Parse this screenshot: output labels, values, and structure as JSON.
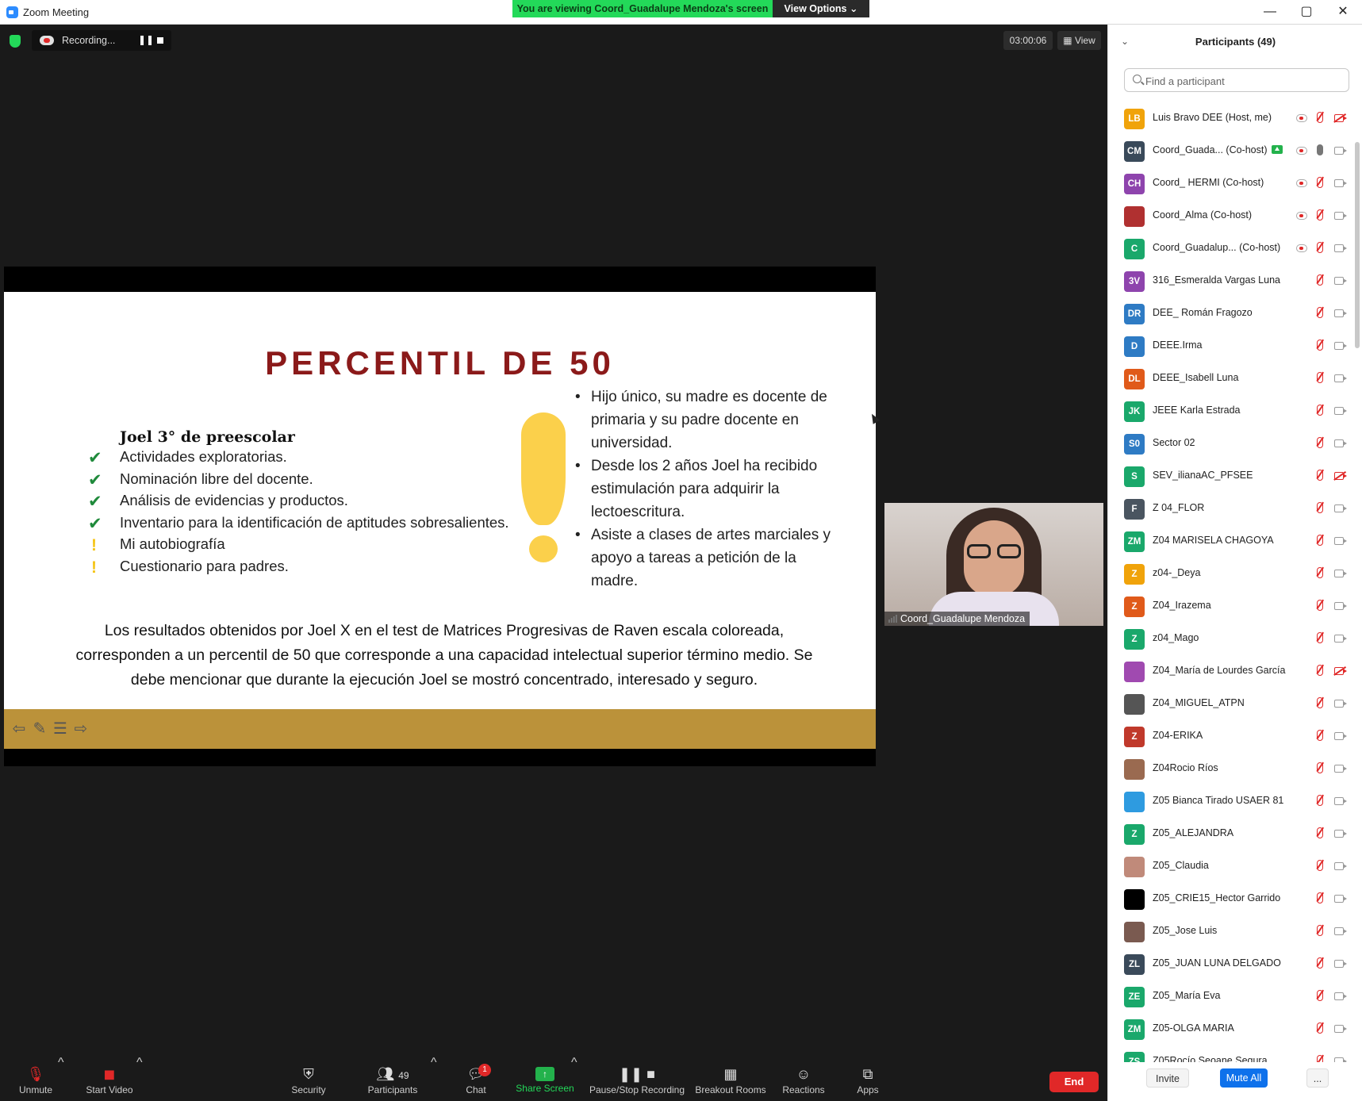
{
  "window": {
    "title": "Zoom Meeting",
    "viewing_banner": "You are viewing Coord_Guadalupe Mendoza's screen",
    "view_options": "View Options ⌄",
    "controls": [
      "—",
      "▢",
      "✕"
    ]
  },
  "top_bar": {
    "recording_label": "Recording...",
    "timer": "03:00:06",
    "view_label": "View"
  },
  "slide": {
    "title": "PERCENTIL  DE 50",
    "subhead": "Joel 3° de preescolar",
    "items": [
      {
        "mark": "check",
        "text": "Actividades exploratorias."
      },
      {
        "mark": "check",
        "text": "Nominación libre del docente."
      },
      {
        "mark": "check",
        "text": "Análisis de evidencias y productos."
      },
      {
        "mark": "check",
        "text": "Inventario para la identificación de aptitudes sobresalientes."
      },
      {
        "mark": "warn",
        "text": "Mi autobiografía"
      },
      {
        "mark": "warn",
        "text": "Cuestionario para padres."
      }
    ],
    "bullets": [
      "Hijo único, su madre es docente de primaria y su padre docente en universidad.",
      "Desde los 2 años Joel ha recibido estimulación para adquirir la lectoescritura.",
      "Asiste a clases de artes marciales y apoyo a tareas a petición de la madre."
    ],
    "conclusion": "Los resultados obtenidos por  Joel  X en el test de Matrices Progresivas de Raven escala coloreada, corresponden a un percentil de  50 que corresponde a una capacidad intelectual superior término medio. Se debe mencionar que durante la ejecución Joel se mostró concentrado,  interesado y seguro."
  },
  "self_video": {
    "name": "Coord_Guadalupe Mendoza"
  },
  "toolbar": {
    "unmute": "Unmute",
    "start_video": "Start Video",
    "security": "Security",
    "participants": "Participants",
    "participants_count": "49",
    "chat": "Chat",
    "chat_badge": "1",
    "share_screen": "Share Screen",
    "pause_stop_recording": "Pause/Stop Recording",
    "breakout_rooms": "Breakout Rooms",
    "reactions": "Reactions",
    "apps": "Apps",
    "end": "End"
  },
  "panel": {
    "title": "Participants (49)",
    "search_placeholder": "Find a participant",
    "invite": "Invite",
    "mute_all": "Mute All",
    "more": "...",
    "participants": [
      {
        "initials": "LB",
        "color": "#f0a30a",
        "name": "Luis Bravo DEE (Host, me)",
        "rec": true,
        "mic": "muted",
        "cam": "off"
      },
      {
        "initials": "CM",
        "color": "#3a4a5a",
        "name": "Coord_Guada... (Co-host)",
        "sharing": true,
        "rec": true,
        "mic": "on",
        "cam": "on"
      },
      {
        "initials": "CH",
        "color": "#8e44ad",
        "name": "Coord_ HERMI (Co-host)",
        "rec": true,
        "mic": "muted",
        "cam": "on"
      },
      {
        "initials": "",
        "color": "#b03030",
        "name": "Coord_Alma (Co-host)",
        "rec": true,
        "mic": "muted",
        "cam": "on"
      },
      {
        "initials": "C",
        "color": "#1aa86b",
        "name": "Coord_Guadalup...  (Co-host)",
        "rec": true,
        "mic": "muted",
        "cam": "on"
      },
      {
        "initials": "3V",
        "color": "#8e44ad",
        "name": "316_Esmeralda Vargas Luna",
        "mic": "muted",
        "cam": "on"
      },
      {
        "initials": "DR",
        "color": "#2e7bc4",
        "name": "DEE_ Román Fragozo",
        "mic": "muted",
        "cam": "on"
      },
      {
        "initials": "D",
        "color": "#2e7bc4",
        "name": "DEEE.Irma",
        "mic": "muted",
        "cam": "on"
      },
      {
        "initials": "DL",
        "color": "#e05a1a",
        "name": "DEEE_Isabell Luna",
        "mic": "muted",
        "cam": "on"
      },
      {
        "initials": "JK",
        "color": "#1aa86b",
        "name": "JEEE Karla Estrada",
        "mic": "muted",
        "cam": "on"
      },
      {
        "initials": "S0",
        "color": "#2e7bc4",
        "name": "Sector 02",
        "mic": "muted",
        "cam": "on"
      },
      {
        "initials": "S",
        "color": "#1aa86b",
        "name": "SEV_ilianaAC_PFSEE",
        "mic": "muted",
        "cam": "off"
      },
      {
        "initials": "F",
        "color": "#4a5560",
        "name": "Z 04_FLOR",
        "mic": "muted",
        "cam": "on"
      },
      {
        "initials": "ZM",
        "color": "#1aa86b",
        "name": "Z04 MARISELA CHAGOYA",
        "mic": "muted",
        "cam": "on"
      },
      {
        "initials": "Z",
        "color": "#f0a30a",
        "name": "z04-_Deya",
        "mic": "muted",
        "cam": "on"
      },
      {
        "initials": "Z",
        "color": "#e05a1a",
        "name": "Z04_Irazema",
        "mic": "muted",
        "cam": "on"
      },
      {
        "initials": "Z",
        "color": "#1aa86b",
        "name": "z04_Mago",
        "mic": "muted",
        "cam": "on"
      },
      {
        "initials": "",
        "color": "#a04ab0",
        "name": "Z04_María de Lourdes García",
        "mic": "muted",
        "cam": "off"
      },
      {
        "initials": "",
        "color": "#555555",
        "name": "Z04_MIGUEL_ATPN",
        "mic": "muted",
        "cam": "on"
      },
      {
        "initials": "Z",
        "color": "#c0392b",
        "name": "Z04-ERIKA",
        "mic": "muted",
        "cam": "on"
      },
      {
        "initials": "",
        "color": "#9a6a50",
        "name": "Z04Rocio Ríos",
        "mic": "muted",
        "cam": "on"
      },
      {
        "initials": "",
        "color": "#2e9be0",
        "name": "Z05 Bianca Tirado USAER 81",
        "mic": "muted",
        "cam": "on"
      },
      {
        "initials": "Z",
        "color": "#1aa86b",
        "name": "Z05_ALEJANDRA",
        "mic": "muted",
        "cam": "on"
      },
      {
        "initials": "",
        "color": "#c08a7a",
        "name": "Z05_Claudia",
        "mic": "muted",
        "cam": "on"
      },
      {
        "initials": "",
        "color": "#000000",
        "name": "Z05_CRIE15_Hector Garrido",
        "mic": "muted",
        "cam": "on"
      },
      {
        "initials": "",
        "color": "#7a5a50",
        "name": "Z05_Jose Luis",
        "mic": "muted",
        "cam": "on"
      },
      {
        "initials": "ZL",
        "color": "#3a4a5a",
        "name": "Z05_JUAN LUNA DELGADO",
        "mic": "muted",
        "cam": "on"
      },
      {
        "initials": "ZE",
        "color": "#1aa86b",
        "name": "Z05_María Eva",
        "mic": "muted",
        "cam": "on"
      },
      {
        "initials": "ZM",
        "color": "#1aa86b",
        "name": "Z05-OLGA MARIA",
        "mic": "muted",
        "cam": "on"
      },
      {
        "initials": "ZS",
        "color": "#1aa86b",
        "name": "Z05Rocío Seoane Segura",
        "mic": "muted",
        "cam": "on"
      }
    ]
  }
}
